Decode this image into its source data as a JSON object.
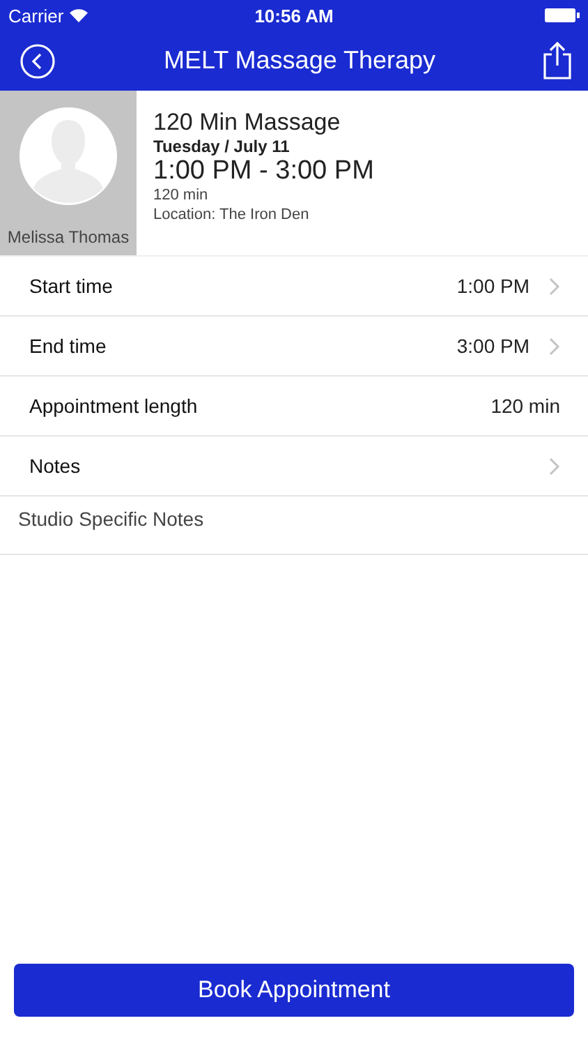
{
  "status_bar": {
    "carrier": "Carrier",
    "time": "10:56 AM"
  },
  "nav": {
    "title": "MELT Massage Therapy"
  },
  "appointment": {
    "staff_name": "Melissa Thomas",
    "title": "120 Min Massage",
    "date": "Tuesday / July 11",
    "time_range": "1:00 PM - 3:00 PM",
    "duration": "120 min",
    "location": "Location: The Iron Den"
  },
  "rows": [
    {
      "label": "Start time",
      "value": "1:00 PM",
      "chevron": true
    },
    {
      "label": "End time",
      "value": "3:00 PM",
      "chevron": true
    },
    {
      "label": "Appointment length",
      "value": "120 min",
      "chevron": false
    },
    {
      "label": "Notes",
      "chevron": true
    }
  ],
  "studio_notes": {
    "label": "Studio Specific Notes"
  },
  "book_button": {
    "label": "Book Appointment"
  }
}
